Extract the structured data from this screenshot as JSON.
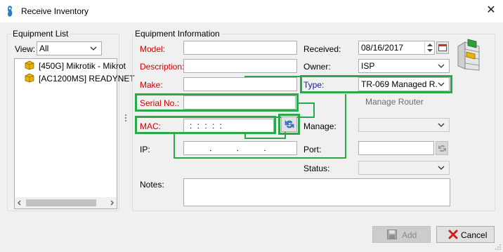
{
  "window": {
    "title": "Receive Inventory",
    "close_glyph": "✕"
  },
  "equipment_list": {
    "label": "Equipment List",
    "view_label": "View:",
    "view_value": "All",
    "items": [
      {
        "label": "[450G] Mikrotik - Mikrot"
      },
      {
        "label": "[AC1200MS] READYNET"
      }
    ]
  },
  "equipment_info": {
    "label": "Equipment Information",
    "model_label": "Model:",
    "description_label": "Description:",
    "make_label": "Make:",
    "serial_label": "Serial No.:",
    "mac_label": "MAC:",
    "mac_value": ": : : : :",
    "ip_label": "IP:",
    "ip_value": ". . .",
    "notes_label": "Notes:",
    "received_label": "Received:",
    "received_value": "08/16/2017",
    "owner_label": "Owner:",
    "owner_value": "ISP",
    "type_label": "Type:",
    "type_value": "TR-069 Managed R...",
    "manage_router_link": "Manage Router",
    "manage_label": "Manage:",
    "port_label": "Port:",
    "status_label": "Status:"
  },
  "buttons": {
    "add": "Add",
    "cancel": "Cancel"
  },
  "icons": [
    "app-icon",
    "router-box-icon",
    "calendar-icon",
    "refresh-mac-icon",
    "port-refresh-icon",
    "equipment-rack-icon",
    "save-icon",
    "cancel-x-icon"
  ],
  "colors": {
    "required": "#d40000",
    "type_label": "#1a1aa6",
    "highlight": "#2aa84a",
    "item_icon": "#e8b400"
  }
}
